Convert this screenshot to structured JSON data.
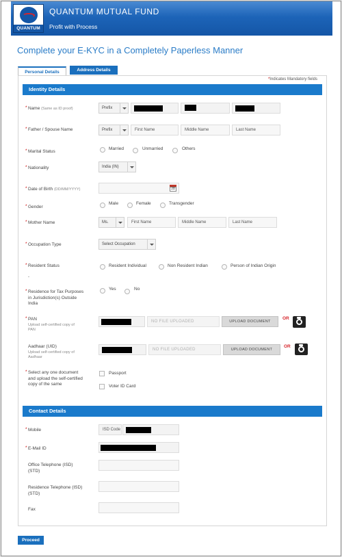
{
  "header": {
    "logo_text": "QUANTUM",
    "brand_name": "QUANTUM MUTUAL FUND",
    "tagline": "Profit with Process"
  },
  "page_title": "Complete your E-KYC in a Completely Paperless Manner",
  "tabs": [
    {
      "label": "Personal Details",
      "active": true
    },
    {
      "label": "Address Details",
      "active": false
    }
  ],
  "mandatory_note": "Indicates Mandatory fields",
  "identity": {
    "title": "Identity Details",
    "name": {
      "label": "Name",
      "hint": "(Same as ID proof)",
      "prefix": "Prefix"
    },
    "father": {
      "label": "Father / Spouse Name",
      "prefix": "Prefix",
      "first_placeholder": "First Name",
      "middle_placeholder": "Middle Name",
      "last_placeholder": "Last Name"
    },
    "marital": {
      "label": "Marital Status",
      "options": [
        "Married",
        "Unmarried",
        "Others"
      ]
    },
    "nationality": {
      "label": "Nationality",
      "value": "India (IN)"
    },
    "dob": {
      "label": "Date of Birth",
      "hint": "(DD/MM/YYYY)",
      "cal_day": "28"
    },
    "gender": {
      "label": "Gender",
      "options": [
        "Male",
        "Female",
        "Transgender"
      ]
    },
    "mother": {
      "label": "Mother Name",
      "prefix": "Ms.",
      "first_placeholder": "First Name",
      "middle_placeholder": "Middle Name",
      "last_placeholder": "Last Name"
    },
    "occupation": {
      "label": "Occupation Type",
      "value": "Select Occupation"
    },
    "resident": {
      "label": "Resident Status",
      "options": [
        "Resident Individual",
        "Non Resident Indian",
        "Person of Indian Origin"
      ]
    },
    "tax": {
      "label_1": "Residence for Tax Purposes",
      "label_2": "in Jurisdiction(s) Outside",
      "label_3": "India",
      "options": [
        "Yes",
        "No"
      ]
    },
    "pan": {
      "label": "PAN",
      "sub_1": "Upload self-certified copy of",
      "sub_2": "PAN",
      "no_file": "NO FILE UPLOADED",
      "upload": "UPLOAD DOCUMENT",
      "or": "OR"
    },
    "aadhaar": {
      "label": "Aadhaar (UID)",
      "sub_1": "Upload self-certified copy of",
      "sub_2": "Aadhaar",
      "no_file": "NO FILE UPLOADED",
      "upload": "UPLOAD DOCUMENT",
      "or": "OR"
    },
    "document": {
      "label_1": "Select any one document",
      "label_2": "and upload the self-certified",
      "label_3": "copy of the same",
      "options": [
        "Passport",
        "Voter ID Card"
      ]
    }
  },
  "contact": {
    "title": "Contact Details",
    "mobile": {
      "label": "Mobile",
      "isd_placeholder": "ISD Code"
    },
    "email": {
      "label": "E-Mail ID"
    },
    "office_phone": {
      "label_1": "Office Telephone (ISD)",
      "label_2": "(STD)"
    },
    "residence_phone": {
      "label_1": "Residence Telephone (ISD)",
      "label_2": "(STD)"
    },
    "fax": {
      "label": "Fax"
    }
  },
  "proceed_label": "Proceed",
  "colors": {
    "primary": "#1a7acb",
    "accent_red": "#d6262c",
    "header_blue": "#1d64b8"
  }
}
